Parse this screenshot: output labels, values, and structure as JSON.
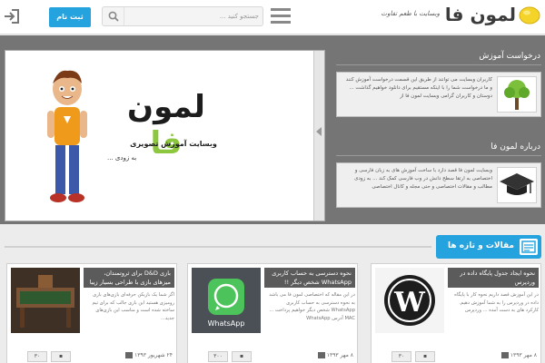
{
  "header": {
    "register_label": "ثبت نام",
    "search_placeholder": "جستجو کنید ...",
    "logo_text": "لمون فا",
    "logo_tagline": "وبسایت با طعم تفاوت"
  },
  "slider": {
    "title": "لمون فا",
    "subtitle": "وبسایت آموزش تصویری",
    "soon": "به زودی ..."
  },
  "sections": [
    {
      "title": "درخواست آموزش",
      "text": "کاربران وبسایت می توانند از طریق این قسمت درخواست آموزش کنند و ما درخواست شما را با اینکه مستقیم برای دانلود خواهیم گذاشت ... دوستان و کاربران گرامی وبسایت لمون فا از"
    },
    {
      "title": "درباره لمون فا",
      "text": "وبسایت لمون فا قصد دارد با ساخت آموزش های به زبان فارسی و اختصاصی به ارتقا سطح دانش در وب فارسی کمک کند ... به زودی مطالب و مقالات اختصاصی و حتی مجله و کانال اختصاصی"
    }
  ],
  "news": {
    "title": "مقالات و تازه ها",
    "cards": [
      {
        "title": "بازی D&D برای ثروتمندان، میزهای بازی با طراحی بسیار زیبا",
        "body": "اگر شما یک بازیکن حرفه‌ای بازی‌های بازی رومیزی هستید این بازی جالب که برای تیم ساخته شده است و مناسب این بازی‌های جدید...",
        "date": "۲۴ شهریور ۱۳۹۳",
        "count": "۳۰"
      },
      {
        "title": "نحوه دسترسی به حساب کاربری WhatsApp شخص دیگر !!",
        "body": "در این مقاله که اختصاصی لمون فا می باشد به نحوه دسترسی به حساب کاربری WhatsApp شخص دیگر خواهیم پرداخت ... MAC آدرس WhatsApp",
        "date": "۸ مهر ۱۳۹۳",
        "count": "۳۰۰"
      },
      {
        "title": "نحوه ایجاد جدول پایگاه داده در وردپرس",
        "body": "در این آموزش قصد داریم نحوه کار با پایگاه داده در وردپرس را به شما آموزش دهیم. کارکرد های به دست آمده ... وردپرس",
        "date": "۸ مهر ۱۳۹۳",
        "count": "۳۰"
      }
    ]
  },
  "colors": {
    "accent": "#25a3df",
    "brand_green": "#8dc63f",
    "hero_bg": "#757575"
  }
}
